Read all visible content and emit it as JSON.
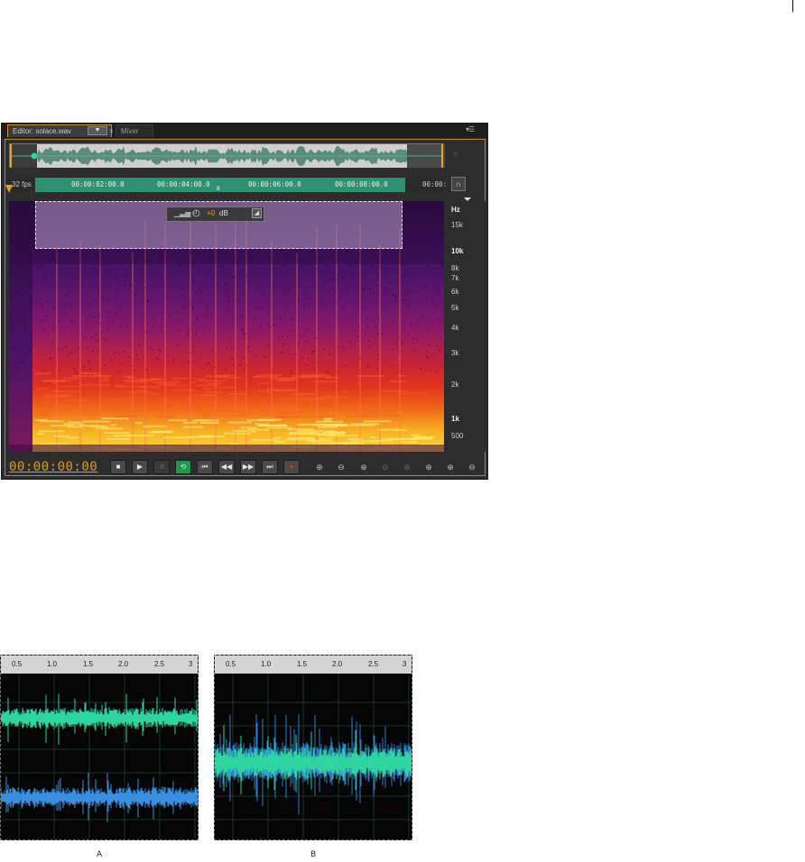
{
  "editor": {
    "tabs": [
      {
        "label": "Editor: solace.wav"
      },
      {
        "label": "Mixer"
      }
    ],
    "tab_dropdown": "▼",
    "tab_close": "×",
    "panel_menu": "▾☰",
    "ruler": {
      "left_label": "32 fps",
      "labels": [
        "00:00:02:00.0",
        "00:00:04:00.0",
        "00:00:06:00.0",
        "00:00:08:00.0",
        "00:00:"
      ],
      "marker_b": "B"
    },
    "hud": {
      "db_sign": "+0",
      "db_unit": "dB"
    },
    "freq_scale": {
      "unit": "Hz",
      "labels": [
        "15k",
        "10k",
        "8k",
        "7k",
        "6k",
        "5k",
        "4k",
        "3k",
        "2k",
        "1k",
        "500"
      ]
    },
    "transport": {
      "time": "00:00:00:00",
      "buttons": [
        "stop",
        "play",
        "pause",
        "loop",
        "go-to-start",
        "rewind",
        "fast-forward",
        "go-to-end",
        "record"
      ],
      "zoom_buttons": [
        "zoom-in-amplitude",
        "zoom-out-amplitude",
        "zoom-in-time",
        "zoom-out-time",
        "zoom-to-selection",
        "zoom-in-left",
        "zoom-in-right",
        "zoom-out-full"
      ]
    },
    "colors": {
      "accent": "#d79c22",
      "ruler_green": "#2f8f72",
      "record": "#d23a2a"
    }
  },
  "figures": [
    {
      "label": "A",
      "ticks": [
        "0.5",
        "1.0",
        "1.5",
        "2.0",
        "2.5",
        "3"
      ],
      "channels": [
        "#2fd4a0",
        "#3a8ee0"
      ]
    },
    {
      "label": "B",
      "ticks": [
        "0.5",
        "1.0",
        "1.5",
        "2.0",
        "2.5",
        "3"
      ],
      "channels": [
        "#2fd4a0"
      ]
    }
  ]
}
